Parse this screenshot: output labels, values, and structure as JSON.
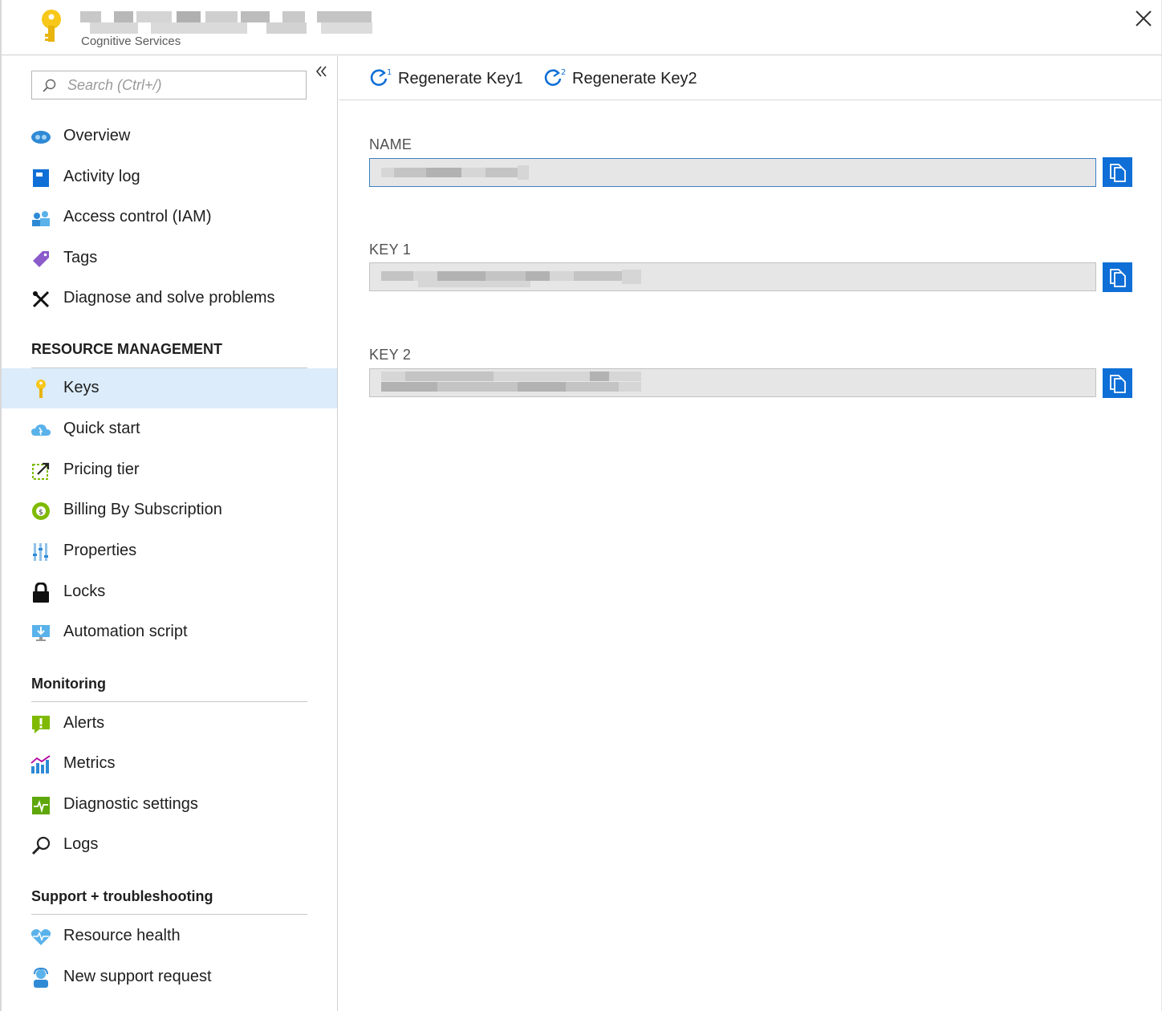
{
  "header": {
    "title": "",
    "subtitle": "Cognitive Services",
    "icon": "key-icon"
  },
  "sidebar": {
    "search_placeholder": "Search (Ctrl+/)",
    "items_top": [
      {
        "label": "Overview",
        "icon": "overview-icon"
      },
      {
        "label": "Activity log",
        "icon": "activity-log-icon"
      },
      {
        "label": "Access control (IAM)",
        "icon": "iam-icon"
      },
      {
        "label": "Tags",
        "icon": "tag-icon"
      },
      {
        "label": "Diagnose and solve problems",
        "icon": "wrench-icon"
      }
    ],
    "resource_management": {
      "heading": "RESOURCE MANAGEMENT",
      "items": [
        {
          "label": "Keys",
          "icon": "key-icon",
          "selected": true
        },
        {
          "label": "Quick start",
          "icon": "cloud-icon"
        },
        {
          "label": "Pricing tier",
          "icon": "pricing-icon"
        },
        {
          "label": "Billing By Subscription",
          "icon": "billing-icon"
        },
        {
          "label": "Properties",
          "icon": "properties-icon"
        },
        {
          "label": "Locks",
          "icon": "lock-icon"
        },
        {
          "label": "Automation script",
          "icon": "automation-icon"
        }
      ]
    },
    "monitoring": {
      "heading": "Monitoring",
      "items": [
        {
          "label": "Alerts",
          "icon": "alert-icon"
        },
        {
          "label": "Metrics",
          "icon": "metrics-icon"
        },
        {
          "label": "Diagnostic settings",
          "icon": "diagnostic-icon"
        },
        {
          "label": "Logs",
          "icon": "logs-icon"
        }
      ]
    },
    "support": {
      "heading": "Support + troubleshooting",
      "items": [
        {
          "label": "Resource health",
          "icon": "heart-icon"
        },
        {
          "label": "New support request",
          "icon": "support-icon"
        }
      ]
    }
  },
  "toolbar": {
    "regen1_label": "Regenerate Key1",
    "regen2_label": "Regenerate Key2"
  },
  "fields": {
    "name_label": "NAME",
    "key1_label": "KEY 1",
    "key2_label": "KEY 2",
    "name_value": "",
    "key1_value": "",
    "key2_value": ""
  },
  "colors": {
    "accent": "#0f6fd6",
    "selected_bg": "#dcecfa",
    "field_bg": "#e6e6e6"
  }
}
